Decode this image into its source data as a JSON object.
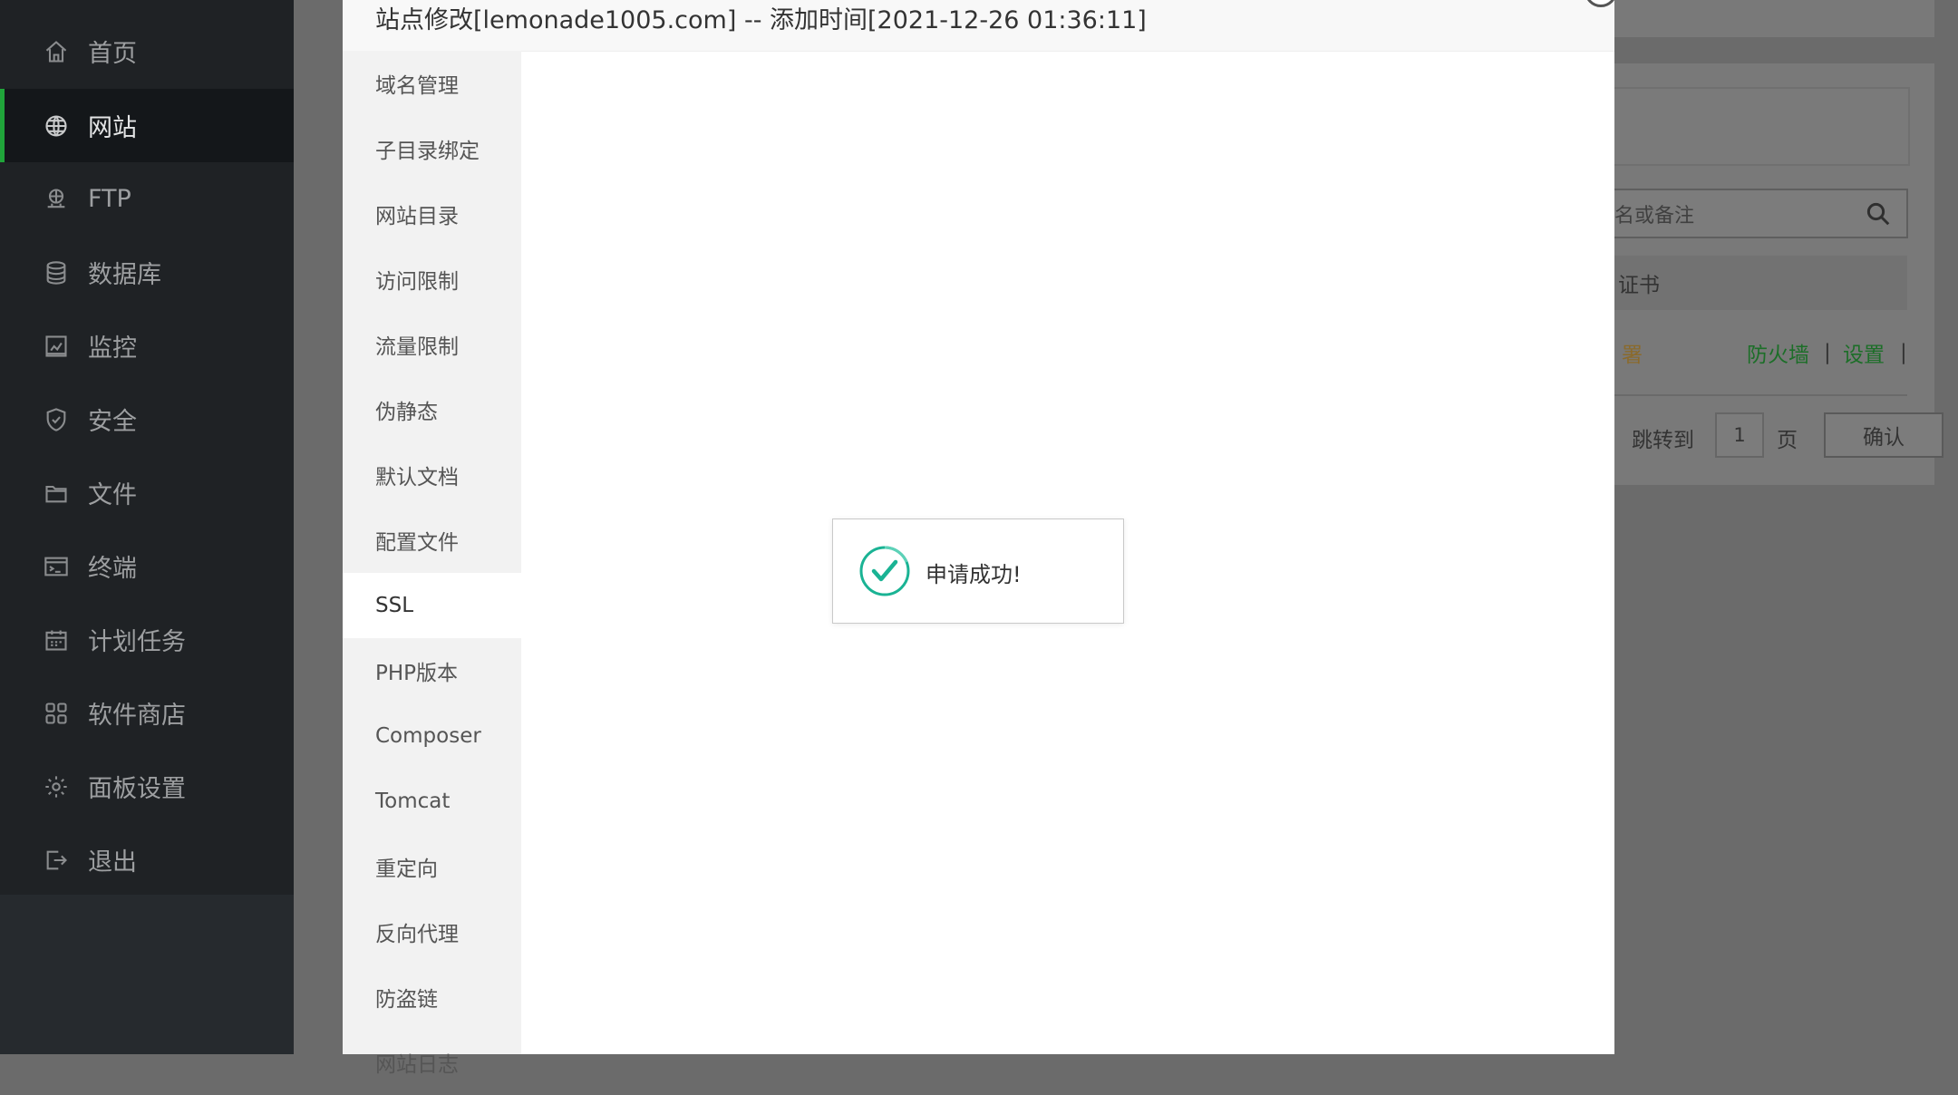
{
  "sidebar": {
    "active_accent": "#20a53a",
    "items": [
      {
        "label": "首页",
        "icon": "home-icon"
      },
      {
        "label": "网站",
        "icon": "globe-icon",
        "active": true
      },
      {
        "label": "FTP",
        "icon": "ftp-icon"
      },
      {
        "label": "数据库",
        "icon": "database-icon"
      },
      {
        "label": "监控",
        "icon": "monitor-icon"
      },
      {
        "label": "安全",
        "icon": "shield-icon"
      },
      {
        "label": "文件",
        "icon": "folder-icon"
      },
      {
        "label": "终端",
        "icon": "terminal-icon"
      },
      {
        "label": "计划任务",
        "icon": "calendar-icon"
      },
      {
        "label": "软件商店",
        "icon": "apps-grid-icon"
      },
      {
        "label": "面板设置",
        "icon": "gear-icon"
      },
      {
        "label": "退出",
        "icon": "logout-icon"
      }
    ]
  },
  "background_page": {
    "search_placeholder": "域名或备注",
    "header_text": "证书",
    "row_deploy_text": "署",
    "row_links": {
      "firewall": "防火墙",
      "settings": "设置",
      "separator": "|"
    },
    "pager": {
      "jump_label": "跳转到",
      "page_value": "1",
      "page_unit": "页",
      "confirm_label": "确认"
    }
  },
  "modal": {
    "title": "站点修改[lemonade1005.com] -- 添加时间[2021-12-26 01:36:11]",
    "tabs": [
      {
        "label": "域名管理"
      },
      {
        "label": "子目录绑定"
      },
      {
        "label": "网站目录"
      },
      {
        "label": "访问限制"
      },
      {
        "label": "流量限制"
      },
      {
        "label": "伪静态"
      },
      {
        "label": "默认文档"
      },
      {
        "label": "配置文件"
      },
      {
        "label": "SSL",
        "active": true
      },
      {
        "label": "PHP版本"
      },
      {
        "label": "Composer"
      },
      {
        "label": "Tomcat"
      },
      {
        "label": "重定向"
      },
      {
        "label": "反向代理"
      },
      {
        "label": "防盗链"
      },
      {
        "label": "网站日志"
      }
    ]
  },
  "toast": {
    "message": "申请成功!",
    "icon": "check-circle-icon",
    "icon_color": "#1ab394"
  }
}
